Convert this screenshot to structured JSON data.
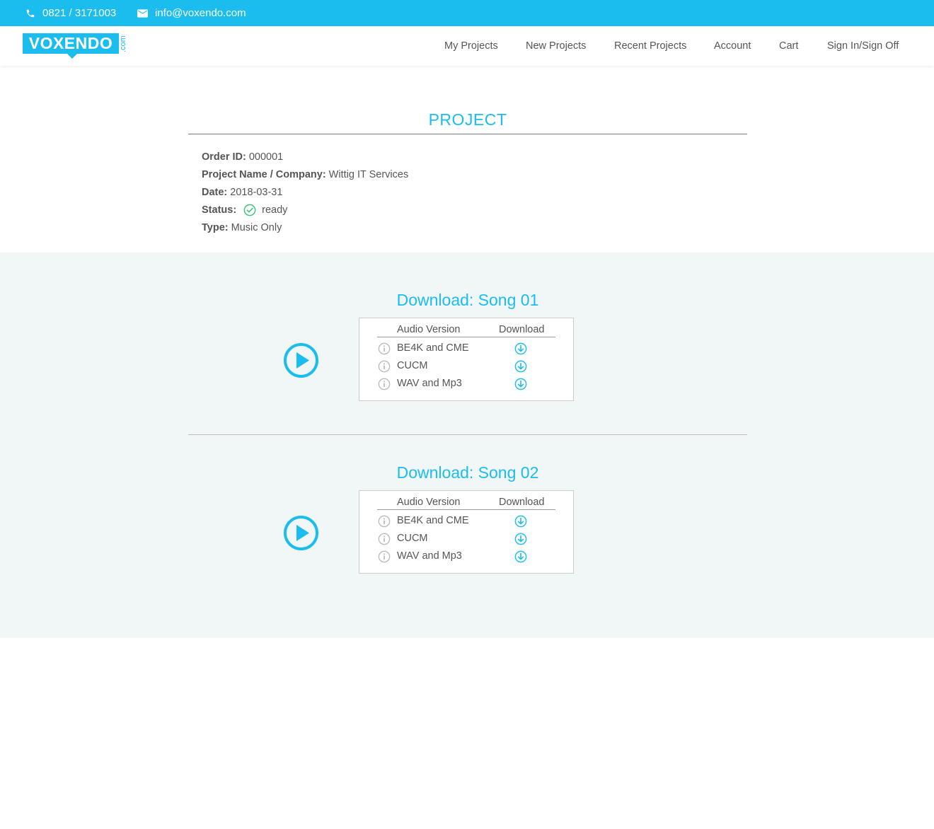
{
  "topbar": {
    "phone": "0821 / 3171003",
    "email": "info@voxendo.com",
    "phone_icon": "phone-icon",
    "email_icon": "mail-icon"
  },
  "logo": {
    "text": "VOXENDO",
    "suffix": ".com"
  },
  "nav": {
    "items": [
      "My Projects",
      "New Projects",
      "Recent Projects",
      "Account",
      "Cart",
      "Sign In/Sign Off"
    ]
  },
  "project": {
    "title": "PROJECT",
    "order_id_label": "Order ID:",
    "order_id": "000001",
    "name_label": "Project Name / Company:",
    "name": "Wittig IT Services",
    "date_label": "Date:",
    "date": "2018-03-31",
    "status_label": "Status:",
    "status": "ready",
    "status_icon": "check-circle-icon",
    "type_label": "Type:",
    "type": "Music Only"
  },
  "songs": [
    {
      "title": "Download: Song 01",
      "col_version": "Audio Version",
      "col_download": "Download",
      "rows": [
        {
          "label": "BE4K and CME"
        },
        {
          "label": "CUCM"
        },
        {
          "label": "WAV and Mp3"
        }
      ]
    },
    {
      "title": "Download: Song 02",
      "col_version": "Audio Version",
      "col_download": "Download",
      "rows": [
        {
          "label": "BE4K and CME"
        },
        {
          "label": "CUCM"
        },
        {
          "label": "WAV and Mp3"
        }
      ]
    }
  ],
  "colors": {
    "accent": "#1bbdef",
    "status_ok": "#3cc47c",
    "section_bg": "#f1f6f6"
  }
}
